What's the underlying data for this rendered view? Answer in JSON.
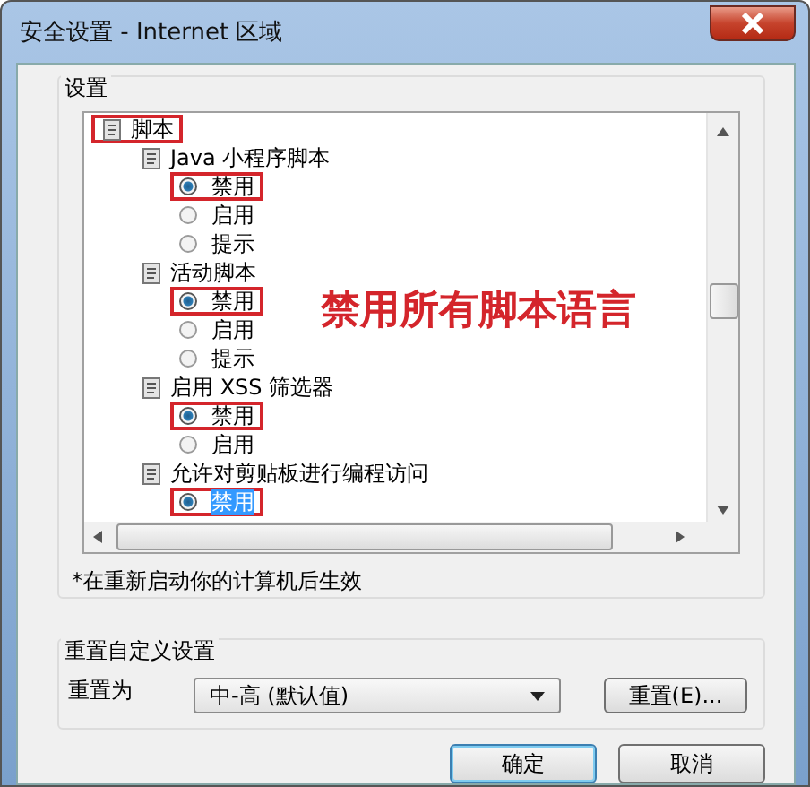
{
  "window": {
    "title": "安全设置 - Internet 区域"
  },
  "settings": {
    "label": "设置",
    "tree": [
      {
        "kind": "group",
        "label": "脚本",
        "highlighted": true,
        "children": [
          {
            "kind": "group",
            "label": "Java 小程序脚本",
            "highlighted": false,
            "children": [
              {
                "kind": "radio",
                "label": "禁用",
                "selected": true,
                "highlighted": true,
                "focused": false
              },
              {
                "kind": "radio",
                "label": "启用",
                "selected": false,
                "highlighted": false,
                "focused": false
              },
              {
                "kind": "radio",
                "label": "提示",
                "selected": false,
                "highlighted": false,
                "focused": false
              }
            ]
          },
          {
            "kind": "group",
            "label": "活动脚本",
            "highlighted": false,
            "children": [
              {
                "kind": "radio",
                "label": "禁用",
                "selected": true,
                "highlighted": true,
                "focused": false
              },
              {
                "kind": "radio",
                "label": "启用",
                "selected": false,
                "highlighted": false,
                "focused": false
              },
              {
                "kind": "radio",
                "label": "提示",
                "selected": false,
                "highlighted": false,
                "focused": false
              }
            ]
          },
          {
            "kind": "group",
            "label": "启用 XSS 筛选器",
            "highlighted": false,
            "children": [
              {
                "kind": "radio",
                "label": "禁用",
                "selected": true,
                "highlighted": true,
                "focused": false
              },
              {
                "kind": "radio",
                "label": "启用",
                "selected": false,
                "highlighted": false,
                "focused": false
              }
            ]
          },
          {
            "kind": "group",
            "label": "允许对剪贴板进行编程访问",
            "highlighted": false,
            "children": [
              {
                "kind": "radio",
                "label": "禁用",
                "selected": true,
                "highlighted": true,
                "focused": true
              }
            ]
          }
        ]
      }
    ],
    "annotation": "禁用所有脚本语言",
    "note": "*在重新启动你的计算机后生效"
  },
  "reset": {
    "label": "重置自定义设置",
    "field_label": "重置为",
    "level_value": "中-高 (默认值)",
    "button": "重置(E)..."
  },
  "buttons": [
    {
      "label": "确定",
      "default": true
    },
    {
      "label": "取消",
      "default": false
    }
  ]
}
